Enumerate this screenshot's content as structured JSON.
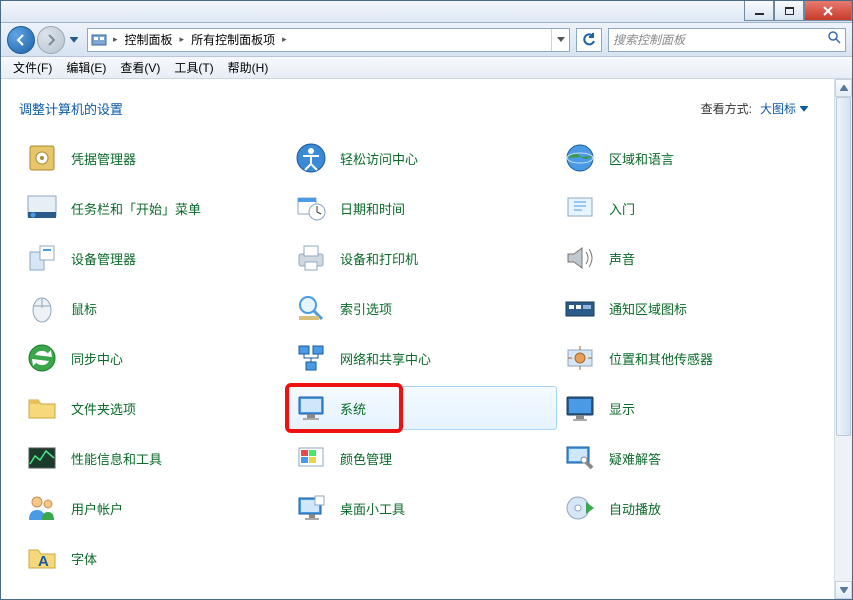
{
  "breadcrumbs": {
    "root_sep": "▸",
    "item1": "控制面板",
    "item2": "所有控制面板项"
  },
  "search": {
    "placeholder": "搜索控制面板"
  },
  "menu": {
    "file": "文件(F)",
    "edit": "编辑(E)",
    "view": "查看(V)",
    "tools": "工具(T)",
    "help": "帮助(H)"
  },
  "heading": "调整计算机的设置",
  "viewmode": {
    "label": "查看方式:",
    "value": "大图标"
  },
  "items": {
    "r0c0": "凭据管理器",
    "r0c1": "轻松访问中心",
    "r0c2": "区域和语言",
    "r1c0": "任务栏和「开始」菜单",
    "r1c1": "日期和时间",
    "r1c2": "入门",
    "r2c0": "设备管理器",
    "r2c1": "设备和打印机",
    "r2c2": "声音",
    "r3c0": "鼠标",
    "r3c1": "索引选项",
    "r3c2": "通知区域图标",
    "r4c0": "同步中心",
    "r4c1": "网络和共享中心",
    "r4c2": "位置和其他传感器",
    "r5c0": "文件夹选项",
    "r5c1": "系统",
    "r5c2": "显示",
    "r6c0": "性能信息和工具",
    "r6c1": "颜色管理",
    "r6c2": "疑难解答",
    "r7c0": "用户帐户",
    "r7c1": "桌面小工具",
    "r7c2": "自动播放",
    "r8c0": "字体"
  }
}
